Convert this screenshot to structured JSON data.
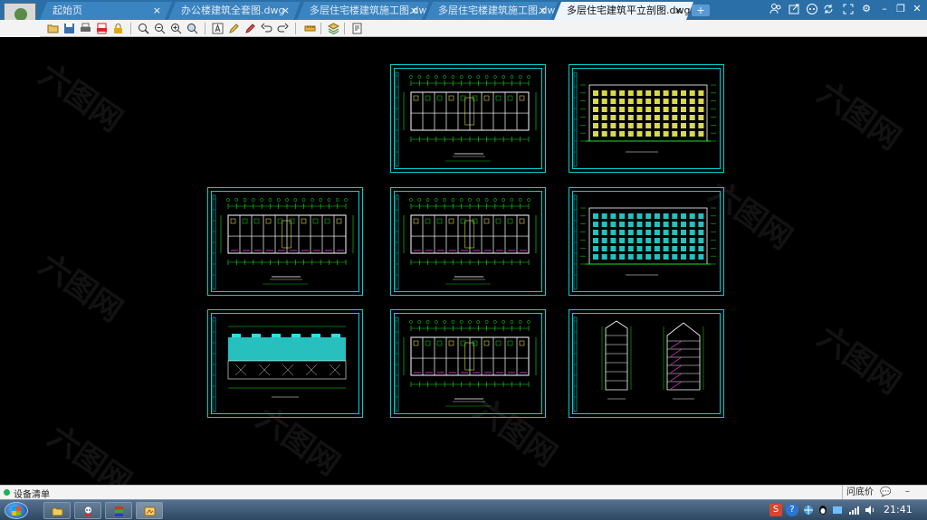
{
  "tabs": [
    {
      "label": "起始页",
      "active": false
    },
    {
      "label": "办公楼建筑全套图.dwg",
      "active": false
    },
    {
      "label": "多层住宅楼建筑施工图.dwg",
      "active": false
    },
    {
      "label": "多层住宅楼建筑施工图.dwg",
      "active": false
    },
    {
      "label": "多层住宅建筑平立剖图.dwg",
      "active": true
    }
  ],
  "tab_close_glyph": "×",
  "tab_add_glyph": "+",
  "window_controls": {
    "settings": "⚙",
    "minimize": "–",
    "restore": "❐",
    "close": "✕"
  },
  "header_icons": [
    "user-group-icon",
    "share-icon",
    "chat-icon",
    "sync-icon",
    "fullscreen-icon"
  ],
  "toolbar_icons": [
    "open-icon",
    "save-icon",
    "print-icon",
    "pdf-icon",
    "lock-icon",
    "zoom-extents-icon",
    "zoom-realtime-icon",
    "zoom-in-icon",
    "zoom-window-icon",
    "text-icon",
    "pencil-icon",
    "cloud-markup-icon",
    "undo-icon",
    "redo-icon",
    "measure-icon",
    "layers-icon",
    "properties-icon"
  ],
  "watermark_text": "六图网",
  "drawings": [
    {
      "id": "plan-top",
      "kind": "plan"
    },
    {
      "id": "elevation-top",
      "kind": "elevation"
    },
    {
      "id": "plan-mid-left",
      "kind": "plan"
    },
    {
      "id": "plan-mid-center",
      "kind": "plan"
    },
    {
      "id": "elevation-mid",
      "kind": "elevation"
    },
    {
      "id": "roof-plan",
      "kind": "roof"
    },
    {
      "id": "plan-bottom-center",
      "kind": "plan"
    },
    {
      "id": "sections",
      "kind": "section"
    }
  ],
  "status": {
    "text": "设备清单",
    "price_query": "问底价",
    "chat_glyph": "💬",
    "minimize_glyph": "–"
  },
  "taskbar": {
    "clock": "21:41",
    "apps": [
      "explorer",
      "avatar-app",
      "stack-app",
      "cad-viewer"
    ]
  },
  "colors": {
    "tab_bar": "#2a6fa8",
    "sheet_border": "#00d2d2",
    "walls": "#ffffff",
    "dimensions": "#16e316",
    "accent_magenta": "#ff3dff",
    "accent_yellow": "#ffff55",
    "cyan_fill": "#2fe0e0"
  }
}
